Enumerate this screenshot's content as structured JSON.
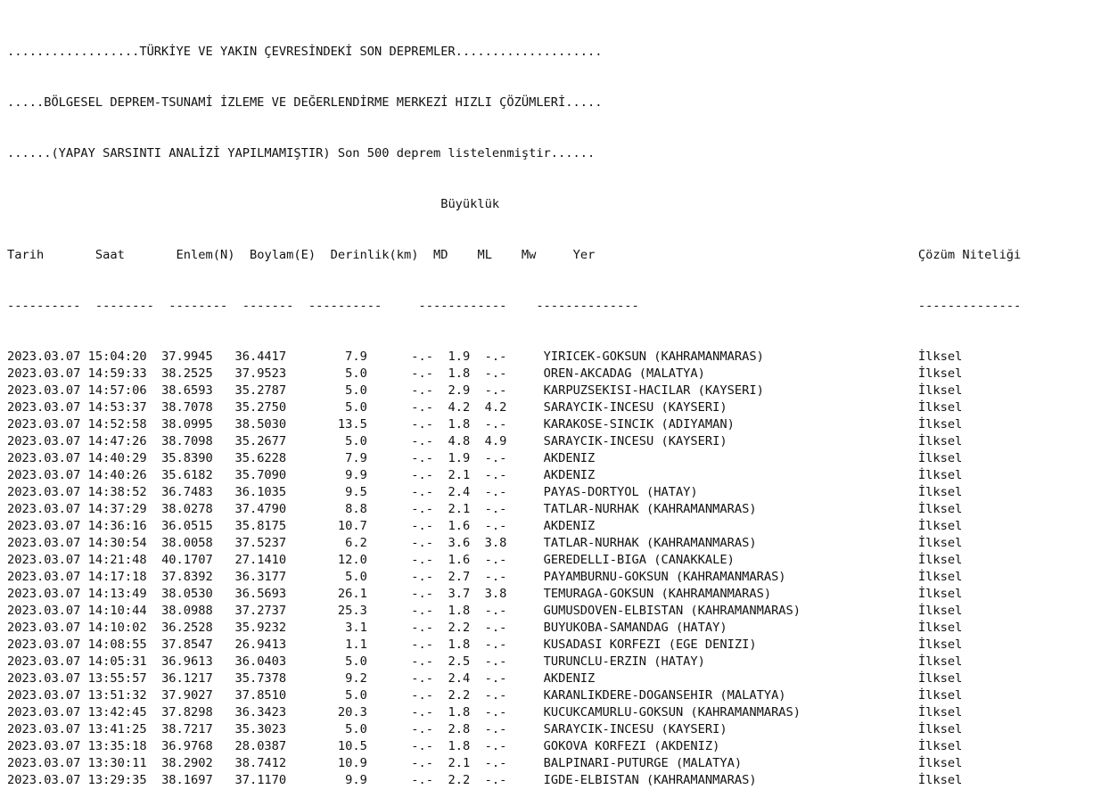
{
  "header": {
    "line1": "..................TÜRKİYE VE YAKIN ÇEVRESİNDEKİ SON DEPREMLER....................",
    "line2": ".....BÖLGESEL DEPREM-TSUNAMİ İZLEME VE DEĞERLENDİRME MERKEZİ HIZLI ÇÖZÜMLERİ.....",
    "line3": "......(YAPAY SARSINTI ANALİZİ YAPILMAMIŞTIR) Son 500 deprem listelenmiştir......"
  },
  "table": {
    "magnitude_group": "Büyüklük",
    "columns": {
      "date": "Tarih",
      "time": "Saat",
      "lat": "Enlem(N)",
      "lon": "Boylam(E)",
      "depth": "Derinlik(km)",
      "md": "MD",
      "ml": "ML",
      "mw": "Mw",
      "place": "Yer",
      "quality": "Çözüm Niteliği"
    },
    "rows": [
      [
        "2023.03.07",
        "15:04:20",
        "37.9945",
        "36.4417",
        "7.9",
        "-.-",
        "1.9",
        "-.-",
        "YIRICEK-GOKSUN (KAHRAMANMARAS)",
        "İlksel"
      ],
      [
        "2023.03.07",
        "14:59:33",
        "38.2525",
        "37.9523",
        "5.0",
        "-.-",
        "1.8",
        "-.-",
        "OREN-AKCADAG (MALATYA)",
        "İlksel"
      ],
      [
        "2023.03.07",
        "14:57:06",
        "38.6593",
        "35.2787",
        "5.0",
        "-.-",
        "2.9",
        "-.-",
        "KARPUZSEKISI-HACILAR (KAYSERI)",
        "İlksel"
      ],
      [
        "2023.03.07",
        "14:53:37",
        "38.7078",
        "35.2750",
        "5.0",
        "-.-",
        "4.2",
        "4.2",
        "SARAYCIK-INCESU (KAYSERI)",
        "İlksel"
      ],
      [
        "2023.03.07",
        "14:52:58",
        "38.0995",
        "38.5030",
        "13.5",
        "-.-",
        "1.8",
        "-.-",
        "KARAKOSE-SINCIK (ADIYAMAN)",
        "İlksel"
      ],
      [
        "2023.03.07",
        "14:47:26",
        "38.7098",
        "35.2677",
        "5.0",
        "-.-",
        "4.8",
        "4.9",
        "SARAYCIK-INCESU (KAYSERI)",
        "İlksel"
      ],
      [
        "2023.03.07",
        "14:40:29",
        "35.8390",
        "35.6228",
        "7.9",
        "-.-",
        "1.9",
        "-.-",
        "AKDENIZ",
        "İlksel"
      ],
      [
        "2023.03.07",
        "14:40:26",
        "35.6182",
        "35.7090",
        "9.9",
        "-.-",
        "2.1",
        "-.-",
        "AKDENIZ",
        "İlksel"
      ],
      [
        "2023.03.07",
        "14:38:52",
        "36.7483",
        "36.1035",
        "9.5",
        "-.-",
        "2.4",
        "-.-",
        "PAYAS-DORTYOL (HATAY)",
        "İlksel"
      ],
      [
        "2023.03.07",
        "14:37:29",
        "38.0278",
        "37.4790",
        "8.8",
        "-.-",
        "2.1",
        "-.-",
        "TATLAR-NURHAK (KAHRAMANMARAS)",
        "İlksel"
      ],
      [
        "2023.03.07",
        "14:36:16",
        "36.0515",
        "35.8175",
        "10.7",
        "-.-",
        "1.6",
        "-.-",
        "AKDENIZ",
        "İlksel"
      ],
      [
        "2023.03.07",
        "14:30:54",
        "38.0058",
        "37.5237",
        "6.2",
        "-.-",
        "3.6",
        "3.8",
        "TATLAR-NURHAK (KAHRAMANMARAS)",
        "İlksel"
      ],
      [
        "2023.03.07",
        "14:21:48",
        "40.1707",
        "27.1410",
        "12.0",
        "-.-",
        "1.6",
        "-.-",
        "GEREDELLI-BIGA (CANAKKALE)",
        "İlksel"
      ],
      [
        "2023.03.07",
        "14:17:18",
        "37.8392",
        "36.3177",
        "5.0",
        "-.-",
        "2.7",
        "-.-",
        "PAYAMBURNU-GOKSUN (KAHRAMANMARAS)",
        "İlksel"
      ],
      [
        "2023.03.07",
        "14:13:49",
        "38.0530",
        "36.5693",
        "26.1",
        "-.-",
        "3.7",
        "3.8",
        "TEMURAGA-GOKSUN (KAHRAMANMARAS)",
        "İlksel"
      ],
      [
        "2023.03.07",
        "14:10:44",
        "38.0988",
        "37.2737",
        "25.3",
        "-.-",
        "1.8",
        "-.-",
        "GUMUSDOVEN-ELBISTAN (KAHRAMANMARAS)",
        "İlksel"
      ],
      [
        "2023.03.07",
        "14:10:02",
        "36.2528",
        "35.9232",
        "3.1",
        "-.-",
        "2.2",
        "-.-",
        "BUYUKOBA-SAMANDAG (HATAY)",
        "İlksel"
      ],
      [
        "2023.03.07",
        "14:08:55",
        "37.8547",
        "26.9413",
        "1.1",
        "-.-",
        "1.8",
        "-.-",
        "KUSADASI KORFEZI (EGE DENIZI)",
        "İlksel"
      ],
      [
        "2023.03.07",
        "14:05:31",
        "36.9613",
        "36.0403",
        "5.0",
        "-.-",
        "2.5",
        "-.-",
        "TURUNCLU-ERZIN (HATAY)",
        "İlksel"
      ],
      [
        "2023.03.07",
        "13:55:57",
        "36.1217",
        "35.7378",
        "9.2",
        "-.-",
        "2.4",
        "-.-",
        "AKDENIZ",
        "İlksel"
      ],
      [
        "2023.03.07",
        "13:51:32",
        "37.9027",
        "37.8510",
        "5.0",
        "-.-",
        "2.2",
        "-.-",
        "KARANLIKDERE-DOGANSEHIR (MALATYA)",
        "İlksel"
      ],
      [
        "2023.03.07",
        "13:42:45",
        "37.8298",
        "36.3423",
        "20.3",
        "-.-",
        "1.8",
        "-.-",
        "KUCUKCAMURLU-GOKSUN (KAHRAMANMARAS)",
        "İlksel"
      ],
      [
        "2023.03.07",
        "13:41:25",
        "38.7217",
        "35.3023",
        "5.0",
        "-.-",
        "2.8",
        "-.-",
        "SARAYCIK-INCESU (KAYSERI)",
        "İlksel"
      ],
      [
        "2023.03.07",
        "13:35:18",
        "36.9768",
        "28.0387",
        "10.5",
        "-.-",
        "1.8",
        "-.-",
        "GOKOVA KORFEZI (AKDENIZ)",
        "İlksel"
      ],
      [
        "2023.03.07",
        "13:30:11",
        "38.2902",
        "38.7412",
        "10.9",
        "-.-",
        "2.1",
        "-.-",
        "BALPINARI-PUTURGE (MALATYA)",
        "İlksel"
      ],
      [
        "2023.03.07",
        "13:29:35",
        "38.1697",
        "37.1170",
        "9.9",
        "-.-",
        "2.2",
        "-.-",
        "IGDE-ELBISTAN (KAHRAMANMARAS)",
        "İlksel"
      ]
    ]
  }
}
